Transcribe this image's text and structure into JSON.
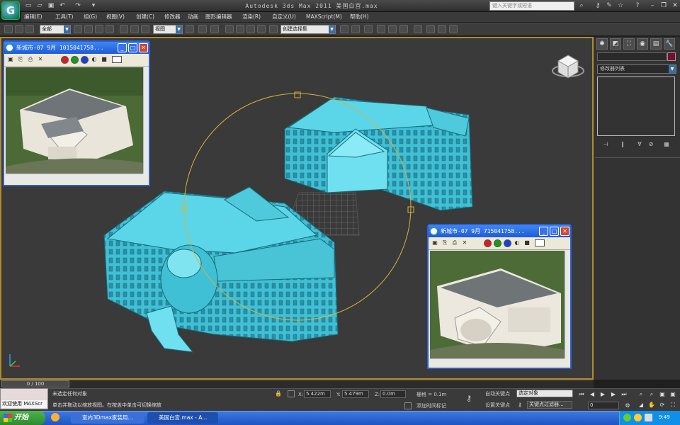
{
  "titlebar": {
    "app_logo": "G",
    "title": "Autodesk 3ds Max  2011     美国白宫.max",
    "help_search_placeholder": "键入关键字或短语"
  },
  "menu": [
    "编辑(E)",
    "工具(T)",
    "组(G)",
    "视图(V)",
    "创建(C)",
    "修改器",
    "动画",
    "图形编辑器",
    "渲染(R)",
    "自定义(U)",
    "MAXScript(M)",
    "帮助(H)"
  ],
  "toolbar": {
    "selection_filter": "全部",
    "reference_coord": "视图",
    "named_selection": "创建选择集"
  },
  "viewcube": {
    "label": "ViewCube"
  },
  "command_panel": {
    "tabs": [
      "✱",
      "◩",
      "⛶",
      "◉",
      "▤",
      "🔧"
    ],
    "modifier_list": "修改器列表",
    "object_color": "#7a0d2e",
    "stack_buttons": [
      "⊣",
      "‖",
      "∀",
      "⊘",
      "▦"
    ]
  },
  "float_window_1": {
    "title": "新城市-07 9月 1015041758..."
  },
  "float_window_2": {
    "title": "新城市-07 9月 715041758..."
  },
  "float_colors": [
    "#d81e1e",
    "#1a9a1a",
    "#1a3fd8"
  ],
  "timeline": {
    "frame": "0 / 100"
  },
  "status": {
    "maxscript_label": "欢迎使用 MAXScr",
    "selection_text": "未选定任何对象",
    "prompt_text": "单击并拖动以缩放视图。在按盖中单击可切换缩放",
    "x_label": "X:",
    "x_value": "5.422m",
    "y_label": "Y:",
    "y_value": "5.479m",
    "z_label": "Z:",
    "z_value": "0.0m",
    "grid_text": "栅格 = 0.1m",
    "add_time_tag": "添加时间标记",
    "auto_key": "自动关键点",
    "selected_set": "选定对象",
    "set_key": "设置关键点",
    "key_filters": "关键点过滤器...",
    "current_frame": "0"
  },
  "taskbar": {
    "start": "开始",
    "tasks": [
      "室内3Dmax家装用...",
      "美国白宫.max - A..."
    ],
    "clock": "9:49"
  }
}
